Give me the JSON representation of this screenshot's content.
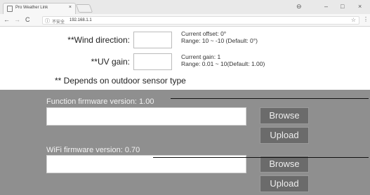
{
  "browser": {
    "tab_title": "Pro Weather Link",
    "tab_close": "×",
    "win_min": "–",
    "win_max": "□",
    "win_close": "×",
    "back": "←",
    "forward": "→",
    "reload": "C",
    "security_icon": "ⓘ",
    "security_label": "不安全",
    "url": "192.168.1.1",
    "star": "☆",
    "menu": "⋮"
  },
  "settings": {
    "wind_label": "**Wind direction:",
    "wind_note_line1": "Current offset: 0°",
    "wind_note_line2": "Range: 10 ~ -10 (Default: 0°)",
    "uv_label": "**UV gain:",
    "uv_note_line1": "Current gain: 1",
    "uv_note_line2": "Range: 0.01 ~ 10(Default: 1.00)",
    "footnote": "** Depends on outdoor sensor type"
  },
  "firmware": {
    "function_label": "Function firmware version: 1.00",
    "wifi_label": "WiFi firmware version: 0.70",
    "browse_label": "Browse",
    "upload_label": "Upload"
  },
  "colors": {
    "panel_background": "#8f8f8f",
    "button_background": "#6b6b6b"
  }
}
